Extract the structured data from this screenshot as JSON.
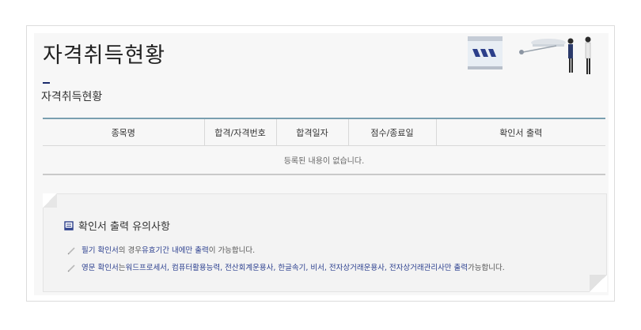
{
  "page": {
    "title": "자격취득현황",
    "section_title": "자격취득현황"
  },
  "table": {
    "columns": [
      "종목명",
      "합격/자격번호",
      "합격일자",
      "점수/종료일",
      "확인서 출력"
    ],
    "empty_message": "등록된 내용이 없습니다."
  },
  "notice": {
    "title": "확인서 출력 유의사항",
    "items": [
      {
        "parts": [
          "필기 확인서",
          "의 경우 ",
          "유효기간 내에만 출력",
          "이 가능합니다."
        ]
      },
      {
        "parts": [
          "영문 확인서",
          "는 ",
          "워드프로세서, 컴퓨터활용능력, 전산회계운용사, 한글속기, 비서, 전자상거래운용사, 전자상거래관리사만 출력",
          " 가능합니다."
        ]
      }
    ]
  },
  "colors": {
    "table_top_border": "#7a9fb0",
    "highlight_text": "#2a3e8e"
  }
}
